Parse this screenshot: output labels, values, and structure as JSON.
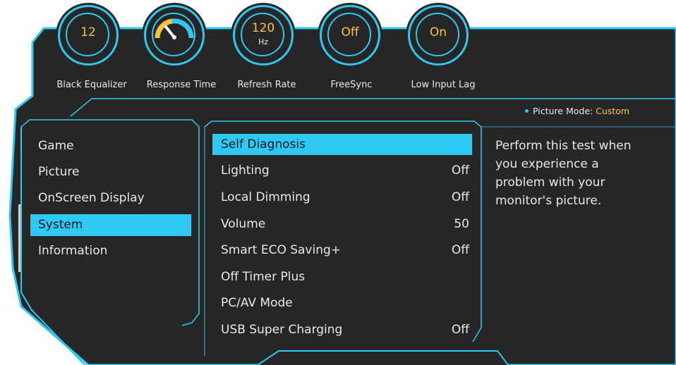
{
  "quick_settings": [
    {
      "value": "12",
      "unit": "",
      "label": "Black Equalizer",
      "icon": ""
    },
    {
      "value": "",
      "unit": "",
      "label": "Response Time",
      "icon": "response-time-gauge-icon"
    },
    {
      "value": "120",
      "unit": "Hz",
      "label": "Refresh Rate",
      "icon": ""
    },
    {
      "value": "Off",
      "unit": "",
      "label": "FreeSync",
      "icon": ""
    },
    {
      "value": "On",
      "unit": "",
      "label": "Low Input Lag",
      "icon": ""
    }
  ],
  "picture_mode": {
    "label": "Picture Mode:",
    "value": "Custom"
  },
  "categories": [
    {
      "label": "Game",
      "selected": false
    },
    {
      "label": "Picture",
      "selected": false
    },
    {
      "label": "OnScreen Display",
      "selected": false
    },
    {
      "label": "System",
      "selected": true
    },
    {
      "label": "Information",
      "selected": false
    }
  ],
  "system_menu": [
    {
      "label": "Self Diagnosis",
      "value": "",
      "selected": true
    },
    {
      "label": "Lighting",
      "value": "Off",
      "selected": false
    },
    {
      "label": "Local Dimming",
      "value": "Off",
      "selected": false
    },
    {
      "label": "Volume",
      "value": "50",
      "selected": false
    },
    {
      "label": "Smart ECO Saving+",
      "value": "Off",
      "selected": false
    },
    {
      "label": "Off Timer Plus",
      "value": "",
      "selected": false
    },
    {
      "label": "PC/AV Mode",
      "value": "",
      "selected": false
    },
    {
      "label": "USB Super Charging",
      "value": "Off",
      "selected": false
    }
  ],
  "description": "Perform this test when you experience a problem with your monitor's picture.",
  "colors": {
    "accent": "#2ec8f2",
    "value_yellow": "#f6c343",
    "panel": "#262626",
    "text": "#e8e8e8"
  }
}
